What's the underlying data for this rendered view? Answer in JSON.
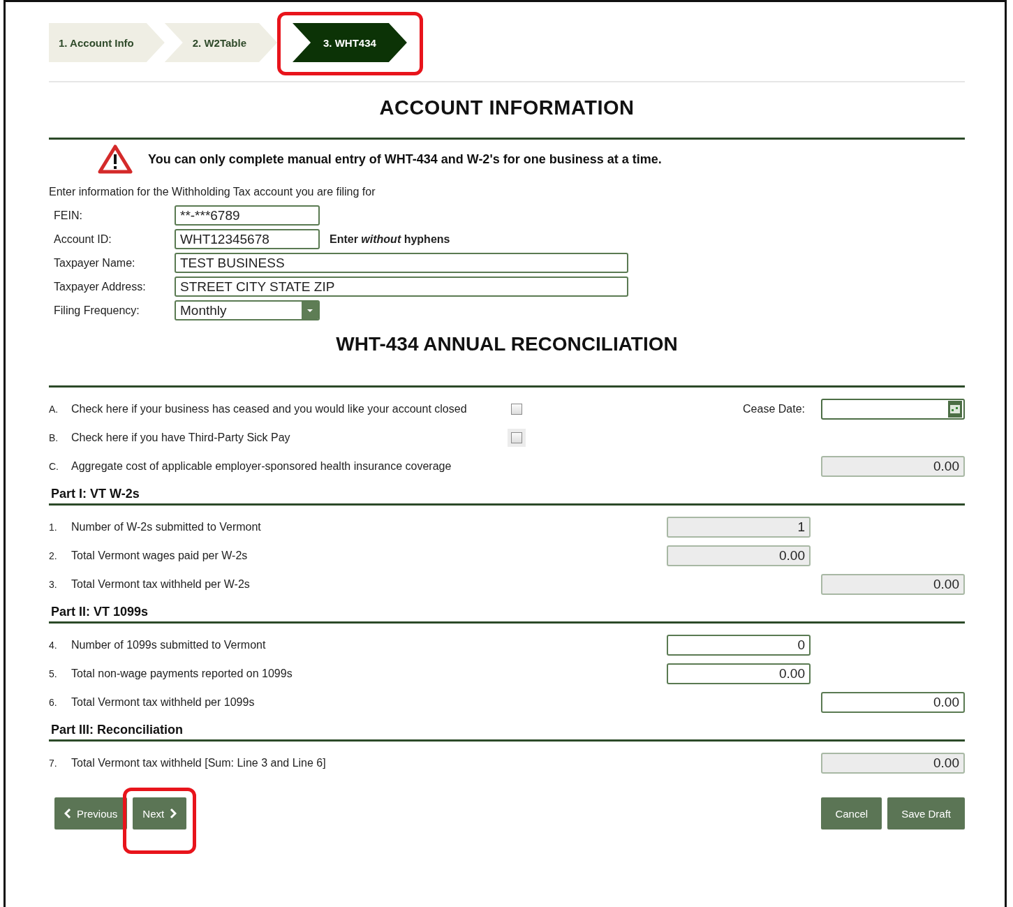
{
  "steps": [
    {
      "label": "1. Account Info",
      "selected": false,
      "highlighted": false
    },
    {
      "label": "2. W2Table",
      "selected": false,
      "highlighted": false
    },
    {
      "label": "3. WHT434",
      "selected": true,
      "highlighted": true
    }
  ],
  "title": "ACCOUNT INFORMATION",
  "warning": "You can only complete manual entry of WHT-434 and W-2's for one business at a time.",
  "intro": "Enter information for the Withholding Tax account you are filing for",
  "account_fields": [
    {
      "label": "FEIN:",
      "value": "**-***6789",
      "kind": "short"
    },
    {
      "label": "Account ID:",
      "value": "WHT12345678",
      "kind": "short",
      "hint": "Enter *without* hyphens"
    },
    {
      "label": "Taxpayer Name:",
      "value": "TEST BUSINESS",
      "kind": "wide"
    },
    {
      "label": "Taxpayer Address:",
      "value": "STREET CITY STATE ZIP",
      "kind": "wide"
    },
    {
      "label": "Filing Frequency:",
      "value": "Monthly",
      "kind": "select"
    }
  ],
  "section_title": "WHT-434 ANNUAL RECONCILIATION",
  "groups": [
    {
      "rows": [
        {
          "marker": "A.",
          "label": "Check here if your business has ceased and you would like your account closed",
          "kind": "checkbox",
          "checked": false,
          "extra_label": "Cease Date:"
        },
        {
          "marker": "B.",
          "label": "Check here if you have Third-Party Sick Pay",
          "kind": "checkbox",
          "checked": false,
          "disabled": true
        },
        {
          "marker": "C.",
          "label": "Aggregate cost of applicable employer-sponsored health insurance coverage",
          "kind": "total",
          "value": "0.00",
          "disabled": true
        }
      ]
    },
    {
      "heading": "Part I: VT W-2s",
      "rows": [
        {
          "marker": "1.",
          "label": "Number of W-2s submitted to Vermont",
          "kind": "subtotal",
          "value": "1",
          "disabled": true
        },
        {
          "marker": "2.",
          "label": "Total Vermont wages paid per W-2s",
          "kind": "subtotal",
          "value": "0.00",
          "disabled": true
        },
        {
          "marker": "3.",
          "label": "Total Vermont tax withheld per W-2s",
          "kind": "total",
          "value": "0.00",
          "disabled": true
        }
      ]
    },
    {
      "heading": "Part II: VT 1099s",
      "rows": [
        {
          "marker": "4.",
          "label": "Number of 1099s submitted to Vermont",
          "kind": "subtotal",
          "value": "0",
          "disabled": false
        },
        {
          "marker": "5.",
          "label": "Total non-wage payments reported on 1099s",
          "kind": "subtotal",
          "value": "0.00",
          "disabled": false
        },
        {
          "marker": "6.",
          "label": "Total Vermont tax withheld per 1099s",
          "kind": "total",
          "value": "0.00",
          "disabled": false
        }
      ]
    },
    {
      "heading": "Part III: Reconciliation",
      "rows": [
        {
          "marker": "7.",
          "label": "Total Vermont tax withheld [Sum: Line 3 and Line 6]",
          "kind": "total",
          "value": "0.00",
          "disabled": true
        }
      ]
    }
  ],
  "nav_buttons": [
    {
      "label": "Previous",
      "kind": "previous",
      "highlighted": false
    },
    {
      "label": "Next",
      "kind": "next",
      "highlighted": true
    }
  ],
  "action_buttons": [
    {
      "label": "Cancel"
    },
    {
      "label": "Save Draft"
    }
  ]
}
